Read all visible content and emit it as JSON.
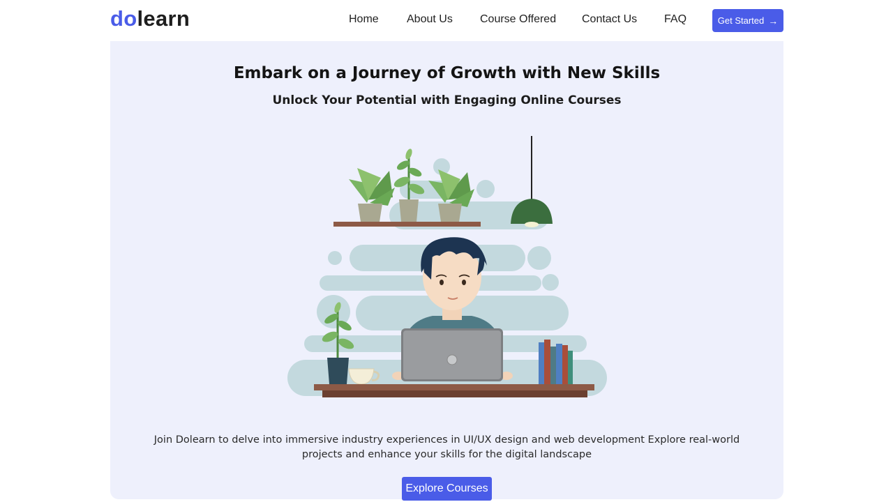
{
  "brand": {
    "logo_prefix": "do",
    "logo_suffix": "learn"
  },
  "nav": {
    "links": [
      "Home",
      "About Us",
      "Course Offered",
      "Contact Us",
      "FAQ"
    ],
    "cta_label": "Get Started",
    "cta_icon": "arrow-right-icon"
  },
  "hero": {
    "title": "Embark on a Journey of Growth with New Skills",
    "subtitle": "Unlock Your Potential with Engaging Online Courses",
    "description": "Join Dolearn to delve into immersive industry experiences in UI/UX design and web development Explore real-world projects and enhance your skills for the digital landscape",
    "button_label": "Explore Courses",
    "illustration": "student-laptop-illustration"
  },
  "colors": {
    "accent": "#4a5ce8",
    "hero_bg": "#eef0fc",
    "text": "#1f1f1f"
  }
}
